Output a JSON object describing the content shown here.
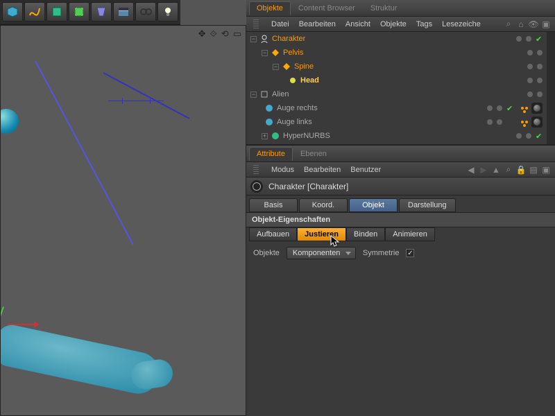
{
  "top_tabs": {
    "objects": "Objekte",
    "content": "Content Browser",
    "structure": "Struktur"
  },
  "obj_menu": {
    "file": "Datei",
    "edit": "Bearbeiten",
    "view": "Ansicht",
    "objects": "Objekte",
    "tags": "Tags",
    "bookmarks": "Lesezeiche"
  },
  "tree": {
    "character": "Charakter",
    "pelvis": "Pelvis",
    "spine": "Spine",
    "head": "Head",
    "alien": "Alien",
    "eye_r": "Auge rechts",
    "eye_l": "Auge links",
    "hypernurbs": "HyperNURBS"
  },
  "attr_tabs": {
    "attribute": "Attribute",
    "layers": "Ebenen"
  },
  "attr_menu": {
    "mode": "Modus",
    "edit": "Bearbeiten",
    "user": "Benutzer"
  },
  "obj_title": "Charakter [Charakter]",
  "prop_tabs": {
    "basis": "Basis",
    "coord": "Koord.",
    "object": "Objekt",
    "display": "Darstellung"
  },
  "section": "Objekt-Eigenschaften",
  "mode_tabs": {
    "build": "Aufbauen",
    "adjust": "Justieren",
    "bind": "Binden",
    "animate": "Animieren"
  },
  "props": {
    "objects_label": "Objekte",
    "components": "Komponenten",
    "symmetry": "Symmetrie"
  }
}
